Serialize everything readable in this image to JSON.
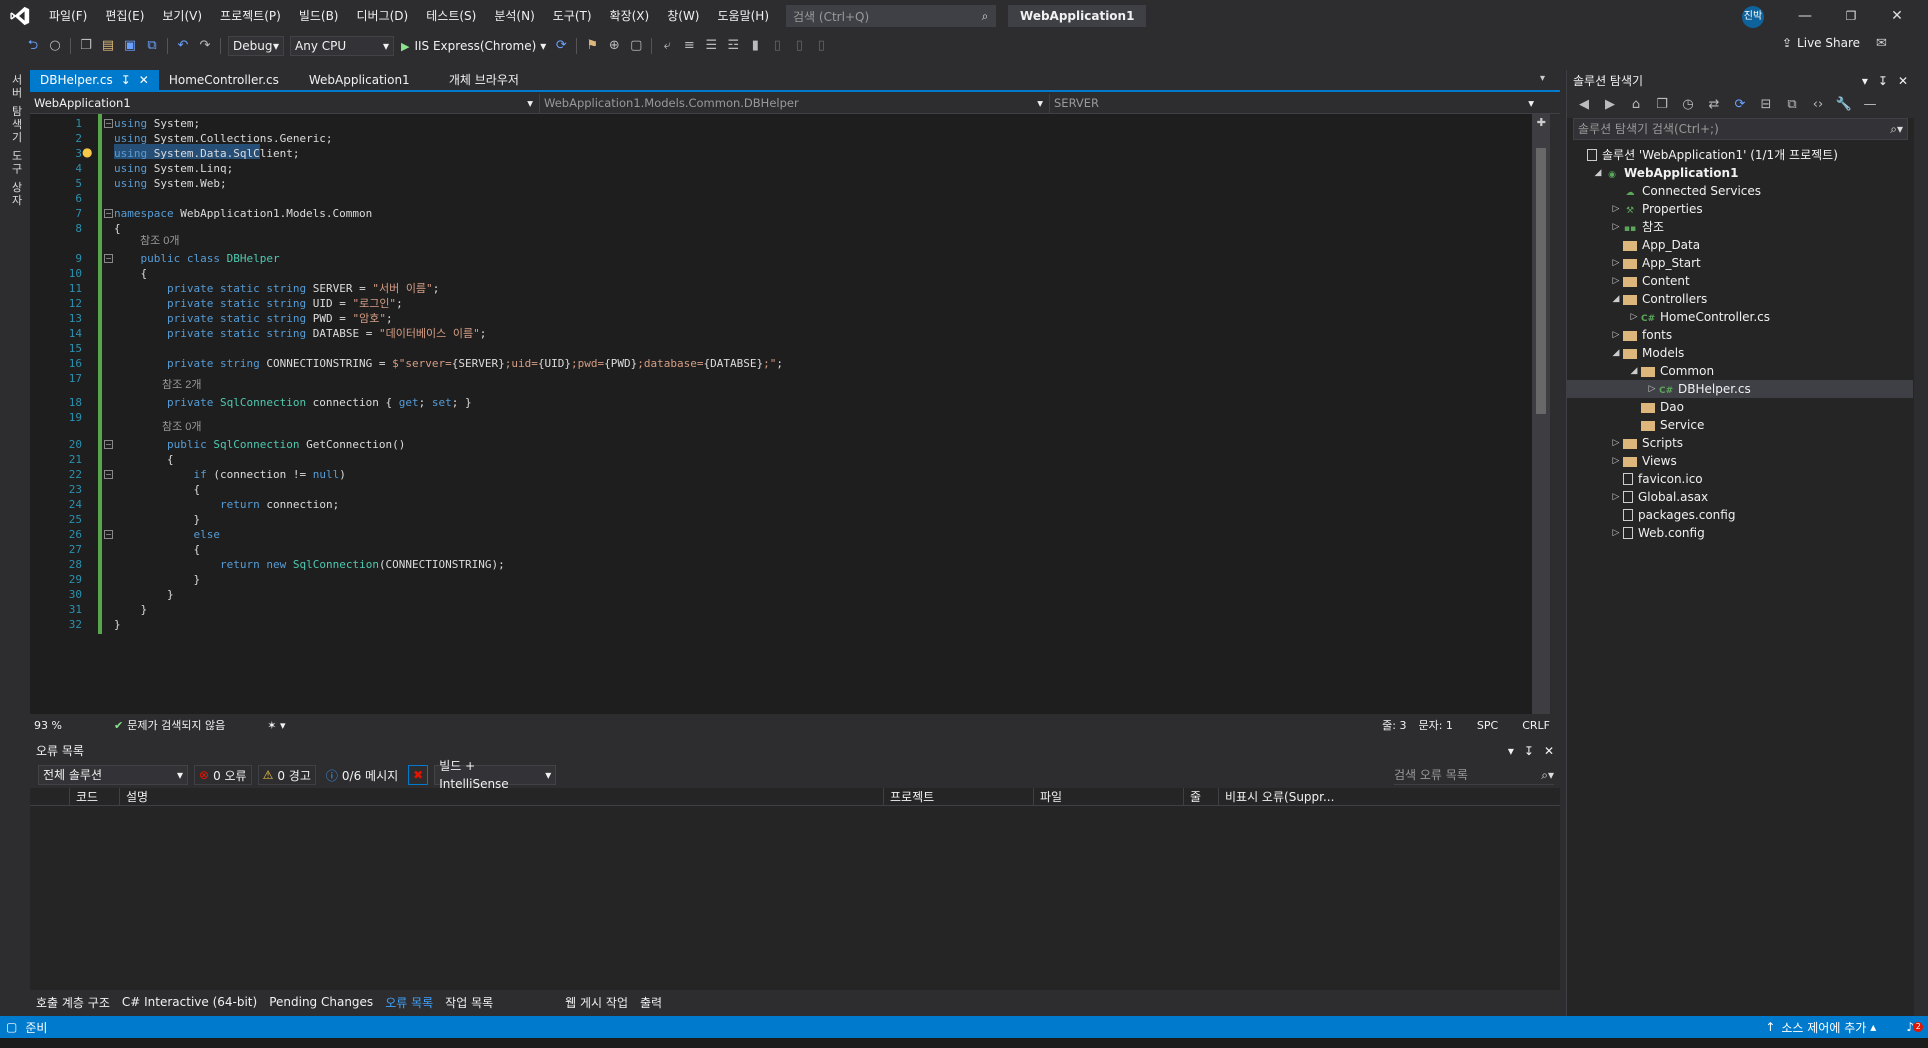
{
  "menubar": {
    "items": [
      "파일(F)",
      "편집(E)",
      "보기(V)",
      "프로젝트(P)",
      "빌드(B)",
      "디버그(D)",
      "테스트(S)",
      "분석(N)",
      "도구(T)",
      "확장(X)",
      "창(W)",
      "도움말(H)"
    ],
    "search_placeholder": "검색 (Ctrl+Q)",
    "solution_name": "WebApplication1",
    "avatar_text": "진박"
  },
  "toolbar": {
    "config": "Debug",
    "platform": "Any CPU",
    "run_label": "IIS Express(Chrome)",
    "live_share": "Live Share"
  },
  "left_rail": [
    "서버 탐색기",
    "도구 상자"
  ],
  "doc_tabs": [
    {
      "label": "DBHelper.cs",
      "active": true
    },
    {
      "label": "HomeController.cs",
      "active": false
    },
    {
      "label": "WebApplication1",
      "active": false
    },
    {
      "label": "개체 브라우저",
      "active": false
    }
  ],
  "navbar": {
    "project": "WebApplication1",
    "type": "WebApplication1.Models.Common.DBHelper",
    "member": "SERVER"
  },
  "code_lines": [
    {
      "n": 1,
      "html": "<span class='kw'>using</span> System;"
    },
    {
      "n": 2,
      "html": "<span class='kw'>using</span> System.Collections.Generic;"
    },
    {
      "n": 3,
      "html": "<span class='kw'>using</span> System.Data.SqlClient;"
    },
    {
      "n": 4,
      "html": "<span class='kw'>using</span> System.Linq;"
    },
    {
      "n": 5,
      "html": "<span class='kw'>using</span> System.Web;"
    },
    {
      "n": 6,
      "html": ""
    },
    {
      "n": 7,
      "html": "<span class='kw'>namespace</span> WebApplication1.Models.Common"
    },
    {
      "n": 8,
      "html": "{"
    },
    {
      "n": 9,
      "html": "    <span class='kw'>public</span> <span class='kw'>class</span> <span class='ty'>DBHelper</span>"
    },
    {
      "n": 10,
      "html": "    {"
    },
    {
      "n": 11,
      "html": "        <span class='kw'>private</span> <span class='kw'>static</span> <span class='kw'>string</span> SERVER = <span class='st'>\"서버 이름\"</span>;"
    },
    {
      "n": 12,
      "html": "        <span class='kw'>private</span> <span class='kw'>static</span> <span class='kw'>string</span> UID = <span class='st'>\"로그인\"</span>;"
    },
    {
      "n": 13,
      "html": "        <span class='kw'>private</span> <span class='kw'>static</span> <span class='kw'>string</span> PWD = <span class='st'>\"암호\"</span>;"
    },
    {
      "n": 14,
      "html": "        <span class='kw'>private</span> <span class='kw'>static</span> <span class='kw'>string</span> DATABSE = <span class='st'>\"데이터베이스 이름\"</span>;"
    },
    {
      "n": 15,
      "html": ""
    },
    {
      "n": 16,
      "html": "        <span class='kw'>private</span> <span class='kw'>string</span> CONNECTIONSTRING = <span class='st'>$\"server=</span>{SERVER}<span class='st'>;uid=</span>{UID}<span class='st'>;pwd=</span>{PWD}<span class='st'>;database=</span>{DATABSE}<span class='st'>;\"</span>;"
    },
    {
      "n": 17,
      "html": ""
    },
    {
      "n": 18,
      "html": "        <span class='kw'>private</span> <span class='ty'>SqlConnection</span> connection { <span class='kw'>get</span>; <span class='kw'>set</span>; }"
    },
    {
      "n": 19,
      "html": ""
    },
    {
      "n": 20,
      "html": "        <span class='kw'>public</span> <span class='ty'>SqlConnection</span> GetConnection()"
    },
    {
      "n": 21,
      "html": "        {"
    },
    {
      "n": 22,
      "html": "            <span class='kw'>if</span> (connection != <span class='kw'>null</span>)"
    },
    {
      "n": 23,
      "html": "            {"
    },
    {
      "n": 24,
      "html": "                <span class='kw'>return</span> connection;"
    },
    {
      "n": 25,
      "html": "            }"
    },
    {
      "n": 26,
      "html": "            <span class='kw'>else</span>"
    },
    {
      "n": 27,
      "html": "            {"
    },
    {
      "n": 28,
      "html": "                <span class='kw'>return</span> <span class='kw'>new</span> <span class='ty'>SqlConnection</span>(CONNECTIONSTRING);"
    },
    {
      "n": 29,
      "html": "            }"
    },
    {
      "n": 30,
      "html": "        }"
    },
    {
      "n": 31,
      "html": "    }"
    },
    {
      "n": 32,
      "html": "}"
    }
  ],
  "codelens": {
    "ref0": "참조 0개",
    "ref2": "참조 2개"
  },
  "editor_status": {
    "zoom": "93 %",
    "issues": "문제가 검색되지 않음",
    "line": "줄: 3",
    "col": "문자: 1",
    "spc": "SPC",
    "crlf": "CRLF"
  },
  "error_list": {
    "title": "오류 목록",
    "scope": "전체 솔루션",
    "errors": "0 오류",
    "warnings": "0 경고",
    "messages": "0/6 메시지",
    "source": "빌드 + IntelliSense",
    "search_placeholder": "검색 오류 목록",
    "columns": [
      "코드",
      "설명",
      "프로젝트",
      "파일",
      "줄",
      "비표시 오류(Suppr..."
    ]
  },
  "bottom_tabs": [
    {
      "label": "호출 계층 구조",
      "active": false
    },
    {
      "label": "C# Interactive (64-bit)",
      "active": false
    },
    {
      "label": "Pending Changes",
      "active": false
    },
    {
      "label": "오류 목록",
      "active": true
    },
    {
      "label": "작업 목록",
      "active": false
    },
    {
      "label": "웹 게시 작업",
      "active": false
    },
    {
      "label": "출력",
      "active": false
    }
  ],
  "status": {
    "ready": "준비",
    "source_control": "소스 제어에 추가",
    "notifications": "2"
  },
  "solution_explorer": {
    "title": "솔루션 탐색기",
    "search_placeholder": "솔루션 탐색기 검색(Ctrl+;)",
    "nodes": [
      {
        "label": "솔루션 'WebApplication1' (1/1개 프로젝트)",
        "level": 0,
        "arrow": "",
        "icon": "solution"
      },
      {
        "label": "WebApplication1",
        "level": 1,
        "arrow": "◢",
        "icon": "project",
        "bold": true
      },
      {
        "label": "Connected Services",
        "level": 2,
        "arrow": "",
        "icon": "services"
      },
      {
        "label": "Properties",
        "level": 2,
        "arrow": "▷",
        "icon": "wrench"
      },
      {
        "label": "참조",
        "level": 2,
        "arrow": "▷",
        "icon": "refs"
      },
      {
        "label": "App_Data",
        "level": 2,
        "arrow": "",
        "icon": "folder"
      },
      {
        "label": "App_Start",
        "level": 2,
        "arrow": "▷",
        "icon": "folder"
      },
      {
        "label": "Content",
        "level": 2,
        "arrow": "▷",
        "icon": "folder"
      },
      {
        "label": "Controllers",
        "level": 2,
        "arrow": "◢",
        "icon": "folder"
      },
      {
        "label": "HomeController.cs",
        "level": 3,
        "arrow": "▷",
        "icon": "cs"
      },
      {
        "label": "fonts",
        "level": 2,
        "arrow": "▷",
        "icon": "folder"
      },
      {
        "label": "Models",
        "level": 2,
        "arrow": "◢",
        "icon": "folder"
      },
      {
        "label": "Common",
        "level": 3,
        "arrow": "◢",
        "icon": "folder"
      },
      {
        "label": "DBHelper.cs",
        "level": 4,
        "arrow": "▷",
        "icon": "cs",
        "selected": true
      },
      {
        "label": "Dao",
        "level": 3,
        "arrow": "",
        "icon": "folder"
      },
      {
        "label": "Service",
        "level": 3,
        "arrow": "",
        "icon": "folder"
      },
      {
        "label": "Scripts",
        "level": 2,
        "arrow": "▷",
        "icon": "folder"
      },
      {
        "label": "Views",
        "level": 2,
        "arrow": "▷",
        "icon": "folder"
      },
      {
        "label": "favicon.ico",
        "level": 2,
        "arrow": "",
        "icon": "file"
      },
      {
        "label": "Global.asax",
        "level": 2,
        "arrow": "▷",
        "icon": "file"
      },
      {
        "label": "packages.config",
        "level": 2,
        "arrow": "",
        "icon": "file"
      },
      {
        "label": "Web.config",
        "level": 2,
        "arrow": "▷",
        "icon": "file"
      }
    ]
  }
}
